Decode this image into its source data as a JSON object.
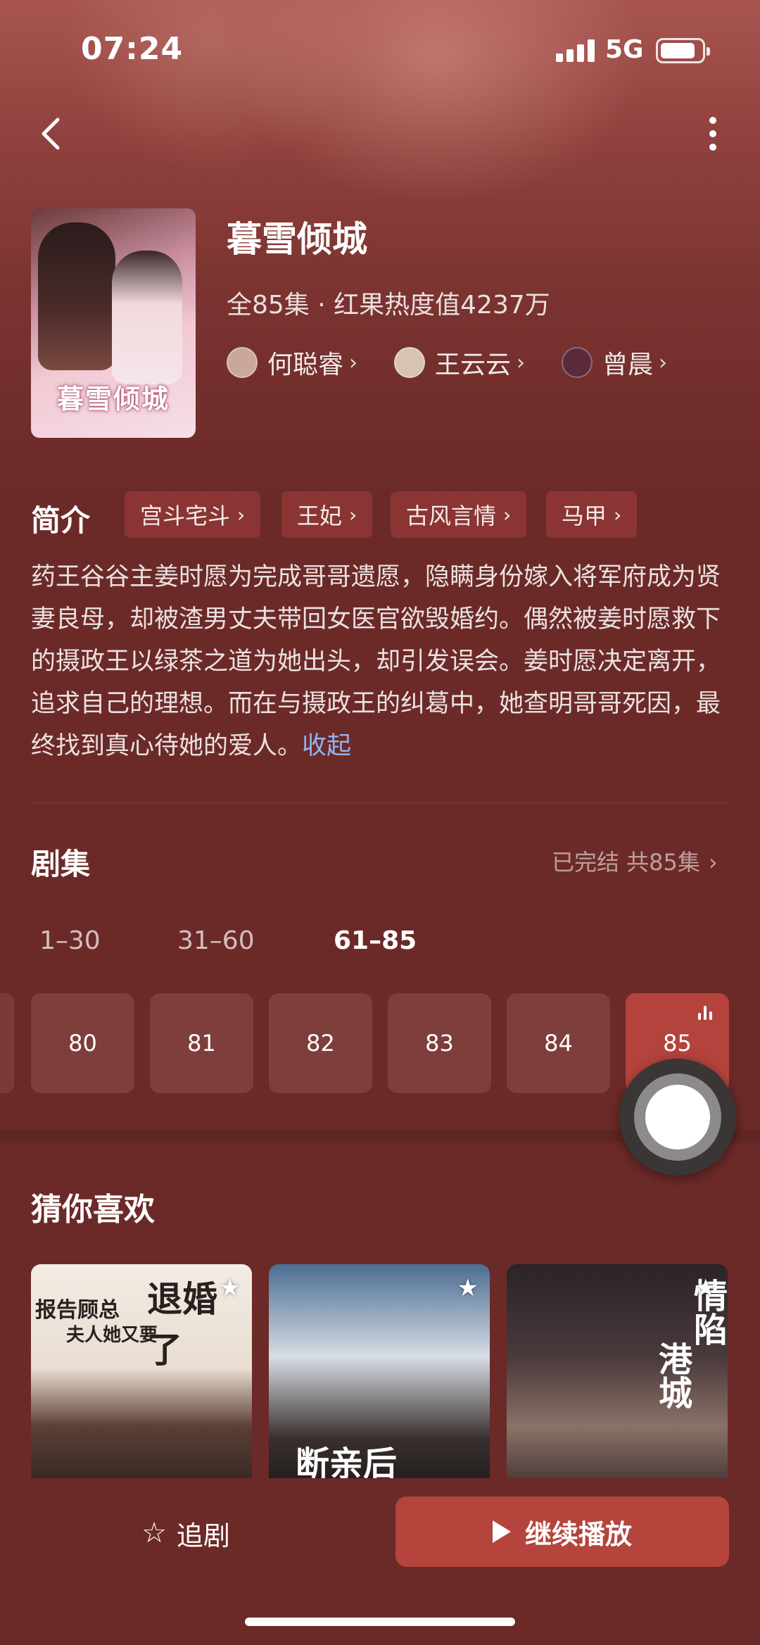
{
  "status_bar": {
    "time": "07:24",
    "network": "5G"
  },
  "drama": {
    "title": "暮雪倾城",
    "poster_text": "暮雪倾城",
    "meta": "全85集 · 红果热度值4237万",
    "actors": [
      {
        "name": "何聪睿",
        "avatar_color": "#c9a89a"
      },
      {
        "name": "王云云",
        "avatar_color": "#d6c3b0"
      },
      {
        "name": "曾晨",
        "avatar_color": "#5a2a3a"
      }
    ]
  },
  "intro": {
    "title": "简介",
    "tags": [
      "宫斗宅斗",
      "王妃",
      "古风言情",
      "马甲"
    ],
    "synopsis": "药王谷谷主姜时愿为完成哥哥遗愿，隐瞒身份嫁入将军府成为贤妻良母，却被渣男丈夫带回女医官欲毁婚约。偶然被姜时愿救下的摄政王以绿茶之道为她出头，却引发误会。姜时愿决定离开，追求自己的理想。而在与摄政王的纠葛中，她查明哥哥死因，最终找到真心待她的爱人。",
    "collapse_label": "收起"
  },
  "episodes": {
    "title": "剧集",
    "status": "已完结 共85集",
    "ranges": [
      "1–30",
      "31–60",
      "61–85"
    ],
    "active_range": "61–85",
    "items": [
      "80",
      "81",
      "82",
      "83",
      "84",
      "85"
    ],
    "current": "85"
  },
  "recommend": {
    "title": "猜你喜欢",
    "items": [
      {
        "text_a": "报告顾总",
        "text_b": "夫人她又要",
        "text_c": "退婚了"
      },
      {
        "text_a": "断亲后",
        "text_b": "",
        "text_c": ""
      },
      {
        "text_a": "情陷",
        "text_b": "港城",
        "text_c": ""
      }
    ]
  },
  "bottom": {
    "follow_label": "追剧",
    "play_label": "继续播放"
  },
  "colors": {
    "background": "#6b2a28",
    "accent": "#b4443c",
    "link": "#8fb4f0"
  }
}
